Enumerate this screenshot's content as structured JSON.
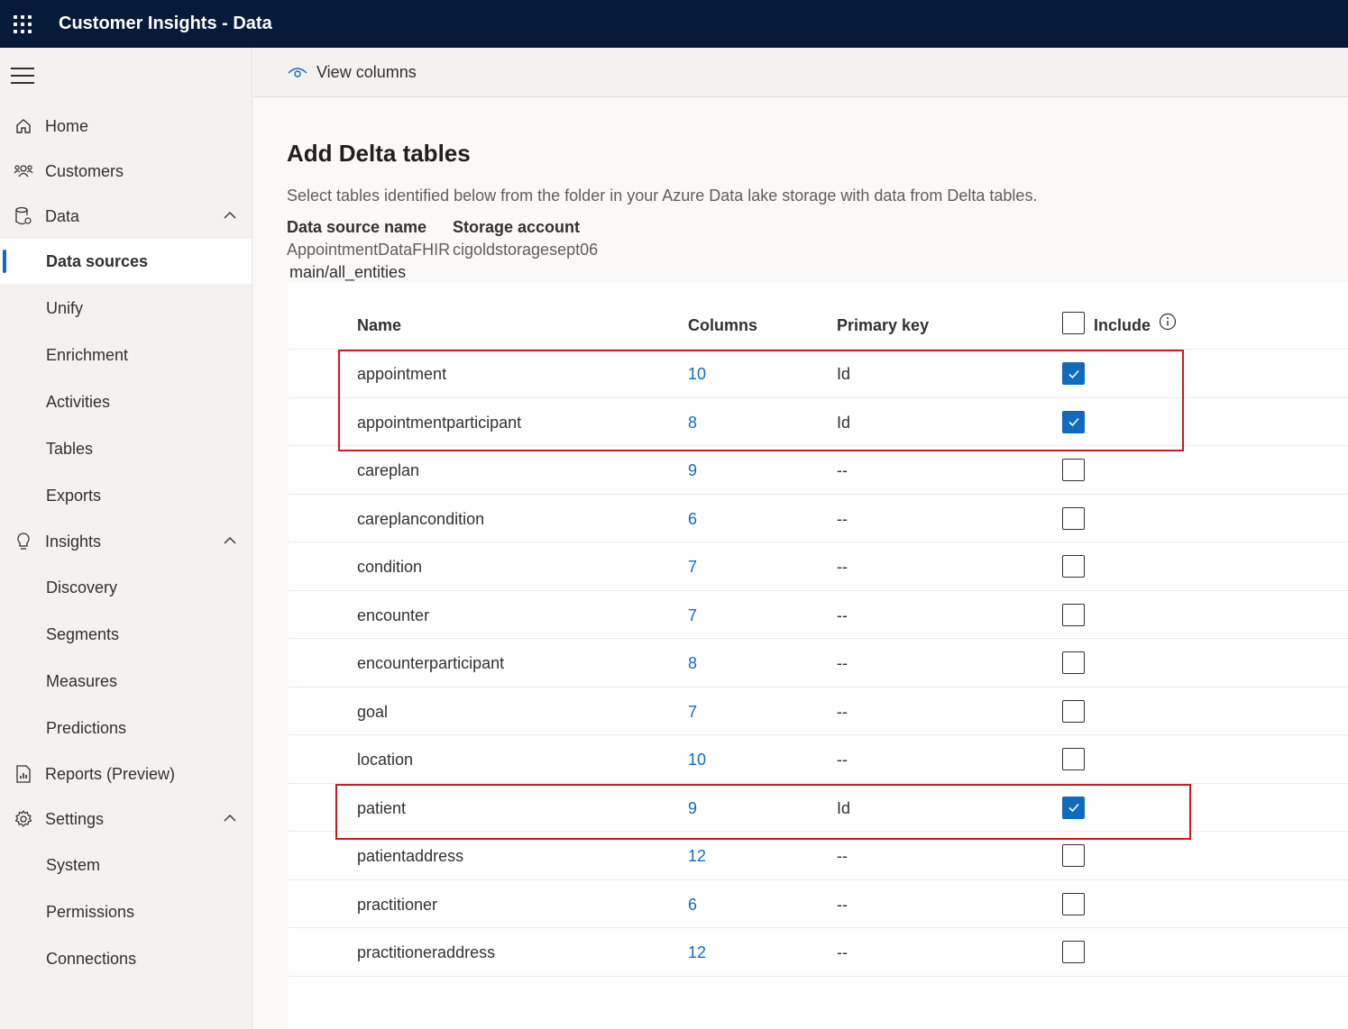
{
  "app": {
    "title": "Customer Insights - Data"
  },
  "sidebar": {
    "items": [
      {
        "label": "Home",
        "icon": "home-icon"
      },
      {
        "label": "Customers",
        "icon": "people-icon"
      },
      {
        "label": "Data",
        "icon": "database-icon",
        "expanded": true
      },
      {
        "label": "Data sources",
        "selected": true
      },
      {
        "label": "Unify"
      },
      {
        "label": "Enrichment"
      },
      {
        "label": "Activities"
      },
      {
        "label": "Tables"
      },
      {
        "label": "Exports"
      },
      {
        "label": "Insights",
        "icon": "lightbulb-icon",
        "expanded": true
      },
      {
        "label": "Discovery"
      },
      {
        "label": "Segments"
      },
      {
        "label": "Measures"
      },
      {
        "label": "Predictions"
      },
      {
        "label": "Reports (Preview)",
        "icon": "report-icon"
      },
      {
        "label": "Settings",
        "icon": "gear-icon",
        "expanded": true
      },
      {
        "label": "System"
      },
      {
        "label": "Permissions"
      },
      {
        "label": "Connections"
      }
    ]
  },
  "commandbar": {
    "view_columns": "View columns"
  },
  "main": {
    "title": "Add Delta tables",
    "description": "Select tables identified below from the folder in your Azure Data lake storage with data from Delta tables.",
    "data_source_label": "Data source name",
    "data_source_value": "AppointmentDataFHIR",
    "storage_label": "Storage account",
    "storage_value": "cigoldstoragesept06",
    "folder": "main/all_entities"
  },
  "table": {
    "headers": {
      "name": "Name",
      "columns": "Columns",
      "primary_key": "Primary key",
      "include": "Include"
    },
    "rows": [
      {
        "name": "appointment",
        "columns": "10",
        "primary_key": "Id",
        "included": true
      },
      {
        "name": "appointmentparticipant",
        "columns": "8",
        "primary_key": "Id",
        "included": true
      },
      {
        "name": "careplan",
        "columns": "9",
        "primary_key": "--",
        "included": false
      },
      {
        "name": "careplancondition",
        "columns": "6",
        "primary_key": "--",
        "included": false
      },
      {
        "name": "condition",
        "columns": "7",
        "primary_key": "--",
        "included": false
      },
      {
        "name": "encounter",
        "columns": "7",
        "primary_key": "--",
        "included": false
      },
      {
        "name": "encounterparticipant",
        "columns": "8",
        "primary_key": "--",
        "included": false
      },
      {
        "name": "goal",
        "columns": "7",
        "primary_key": "--",
        "included": false
      },
      {
        "name": "location",
        "columns": "10",
        "primary_key": "--",
        "included": false
      },
      {
        "name": "patient",
        "columns": "9",
        "primary_key": "Id",
        "included": true
      },
      {
        "name": "patientaddress",
        "columns": "12",
        "primary_key": "--",
        "included": false
      },
      {
        "name": "practitioner",
        "columns": "6",
        "primary_key": "--",
        "included": false
      },
      {
        "name": "practitioneraddress",
        "columns": "12",
        "primary_key": "--",
        "included": false
      }
    ]
  },
  "colors": {
    "topbar": "#061a3a",
    "accent": "#0f6cbd",
    "highlight": "#d1171f"
  }
}
